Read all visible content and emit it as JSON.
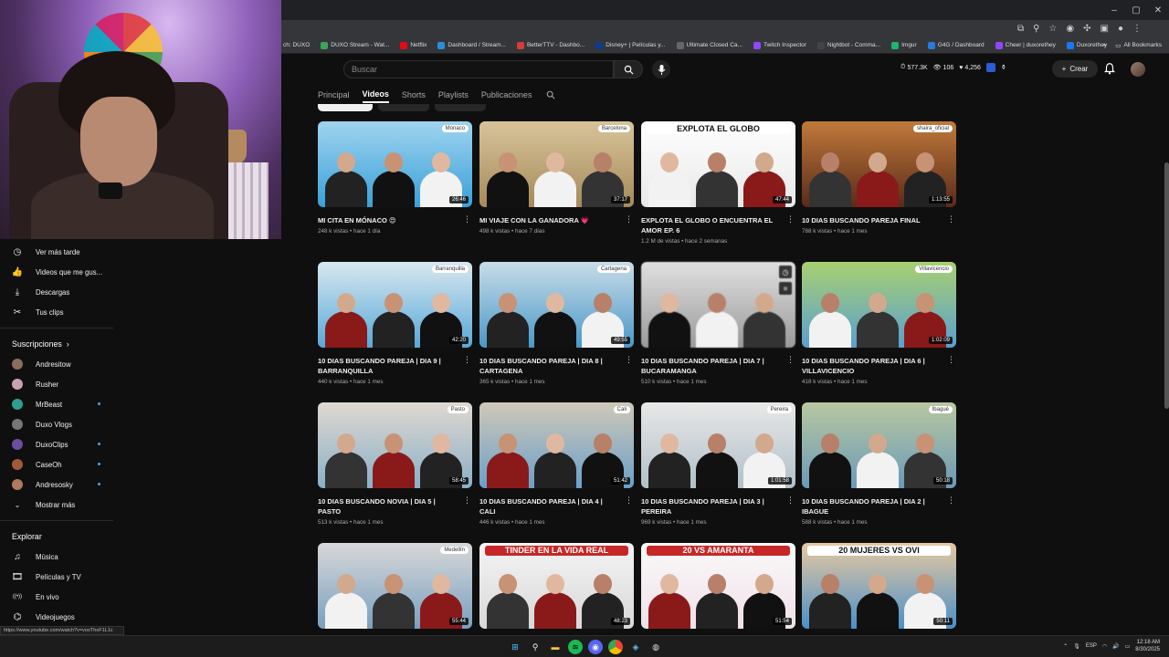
{
  "bookmarks": [
    "DUXO Stream - Wat...",
    "Netflix",
    "Dashboard / Stream...",
    "BetterTTV - Dashbo...",
    "Disney+ | Películas y...",
    "Ultimate Closed Ca...",
    "Twitch Inspector",
    "Nightbot - Comma...",
    "Imgur",
    "G4G / Dashboard",
    "Cheer | duxorethey",
    "Duxorethey"
  ],
  "bookmarks_prefix": "ch: DUXO",
  "all_bookmarks": "All Bookmarks",
  "search": {
    "placeholder": "Buscar"
  },
  "stats": {
    "views": "577.3K",
    "viewers": "106",
    "followers": "4,256"
  },
  "create_label": "Crear",
  "tabs": [
    "Principal",
    "Videos",
    "Shorts",
    "Playlists",
    "Publicaciones"
  ],
  "active_tab": "Videos",
  "sidebar": {
    "library": [
      {
        "label": "Ver más tarde",
        "icon": "clock-icon"
      },
      {
        "label": "Videos que me gus...",
        "icon": "thumbs-up-icon"
      },
      {
        "label": "Descargas",
        "icon": "download-icon"
      },
      {
        "label": "Tus clips",
        "icon": "scissors-icon"
      }
    ],
    "subs_header": "Suscripciones",
    "subscriptions": [
      {
        "label": "Andresitow",
        "color": "#8a6d5a",
        "live": false
      },
      {
        "label": "Rusher",
        "color": "#c9a0b0",
        "live": false
      },
      {
        "label": "MrBeast",
        "color": "#2f9e8f",
        "live": true
      },
      {
        "label": "Duxo Vlogs",
        "color": "#777",
        "live": false
      },
      {
        "label": "DuxoClips",
        "color": "#6a4fa0",
        "live": true
      },
      {
        "label": "CaseOh",
        "color": "#a05a3a",
        "live": true
      },
      {
        "label": "Andresosky",
        "color": "#b07a60",
        "live": true
      }
    ],
    "more_label": "Mostrar más",
    "explore_header": "Explorar",
    "explore": [
      {
        "label": "Música",
        "icon": "music-icon"
      },
      {
        "label": "Películas y TV",
        "icon": "film-icon"
      },
      {
        "label": "En vivo",
        "icon": "live-icon"
      },
      {
        "label": "Videojuegos",
        "icon": "gamepad-icon"
      }
    ]
  },
  "status_url": "https://www.youtube.com/watch?v=vooTheF1L1c",
  "videos": [
    {
      "title": "MI CITA EN MÓNACO 😍",
      "meta": "248 k vistas • hace 1 día",
      "duration": "26:46",
      "loc": "Monaco",
      "bg": [
        "#3aa0d8",
        "#9fd4ef"
      ]
    },
    {
      "title": "MI VIAJE CON LA GANADORA 💗",
      "meta": "498 k vistas • hace 7 días",
      "duration": "37:17",
      "loc": "Barcelona",
      "bg": [
        "#a58a5a",
        "#d8c49a"
      ]
    },
    {
      "title": "EXPLOTA EL GLOBO O ENCUENTRA EL AMOR EP. 6",
      "meta": "1.2 M de vistas • hace 2 semanas",
      "duration": "47:44",
      "banner": "EXPLOTA EL GLOBO",
      "bg": [
        "#e8e8e8",
        "#ffffff"
      ]
    },
    {
      "title": "10 DIAS BUSCANDO PAREJA FINAL",
      "meta": "788 k vistas • hace 1 mes",
      "duration": "1:13:55",
      "loc": "shaira_oficial",
      "bg": [
        "#5a2a1a",
        "#c07a3a"
      ]
    },
    {
      "title": "10 DIAS BUSCANDO PAREJA | DIA 9 | BARRANQUILLA",
      "meta": "440 k vistas • hace 1 mes",
      "duration": "42:20",
      "loc": "Barranquilla",
      "bg": [
        "#58a8d8",
        "#d8e8ef"
      ]
    },
    {
      "title": "10 DIAS BUSCANDO PAREJA | DIA 8 | CARTAGENA",
      "meta": "365 k vistas • hace 1 mes",
      "duration": "49:55",
      "loc": "Cartagena",
      "bg": [
        "#4a98c8",
        "#c8dce8"
      ]
    },
    {
      "title": "10 DIAS BUSCANDO PAREJA | DIA 7 | BUCARAMANGA",
      "meta": "510 k vistas • hace 1 mes",
      "duration": "",
      "loc": "",
      "bg": [
        "#9a9a9a",
        "#e0e0e0"
      ]
    },
    {
      "title": "10 DIAS BUSCANDO PAREJA | DIA 6 | VILLAVICENCIO",
      "meta": "418 k vistas • hace 1 mes",
      "duration": "1:02:09",
      "loc": "Villavicencio",
      "bg": [
        "#5aa0d0",
        "#a8d070"
      ]
    },
    {
      "title": "10 DIAS BUSCANDO NOVIA | DIA 5 | PASTO",
      "meta": "513 k vistas • hace 1 mes",
      "duration": "58:45",
      "loc": "Pasto",
      "bg": [
        "#8ab0c8",
        "#e0d8d0"
      ]
    },
    {
      "title": "10 DIAS BUSCANDO PAREJA | DIA 4 | CALI",
      "meta": "446 k vistas • hace 1 mes",
      "duration": "51:42",
      "loc": "Cali",
      "bg": [
        "#6aa0c8",
        "#d0c8b8"
      ]
    },
    {
      "title": "10 DIAS BUSCANDO PAREJA | DIA 3 | PEREIRA",
      "meta": "969 k vistas • hace 1 mes",
      "duration": "1:01:58",
      "loc": "Pereira",
      "bg": [
        "#b0c0c8",
        "#e8e8e8"
      ]
    },
    {
      "title": "10 DIAS BUSCANDO PAREJA | DIA 2 | IBAGUE",
      "meta": "588 k vistas • hace 1 mes",
      "duration": "50:18",
      "loc": "Ibagué",
      "bg": [
        "#6a9ab8",
        "#b8c8a0"
      ]
    },
    {
      "title": "",
      "meta": "",
      "duration": "55:44",
      "loc": "Medellín",
      "bg": [
        "#7aa0c0",
        "#d8d8d8"
      ]
    },
    {
      "title": "",
      "meta": "",
      "duration": "48:23",
      "banner": "TINDER EN LA VIDA REAL",
      "bg": [
        "#d8d8d8",
        "#f4f4f4"
      ]
    },
    {
      "title": "",
      "meta": "",
      "duration": "51:54",
      "banner": "20 VS AMARANTA",
      "bg": [
        "#f0e0e8",
        "#fafafa"
      ]
    },
    {
      "title": "",
      "meta": "",
      "duration": "50:11",
      "banner": "20 MUJERES VS OVI",
      "bg": [
        "#4a90c8",
        "#e8c8a0"
      ]
    }
  ],
  "taskbar": {
    "lang": "ESP",
    "time": "12:18 AM",
    "date": "8/30/2025"
  }
}
